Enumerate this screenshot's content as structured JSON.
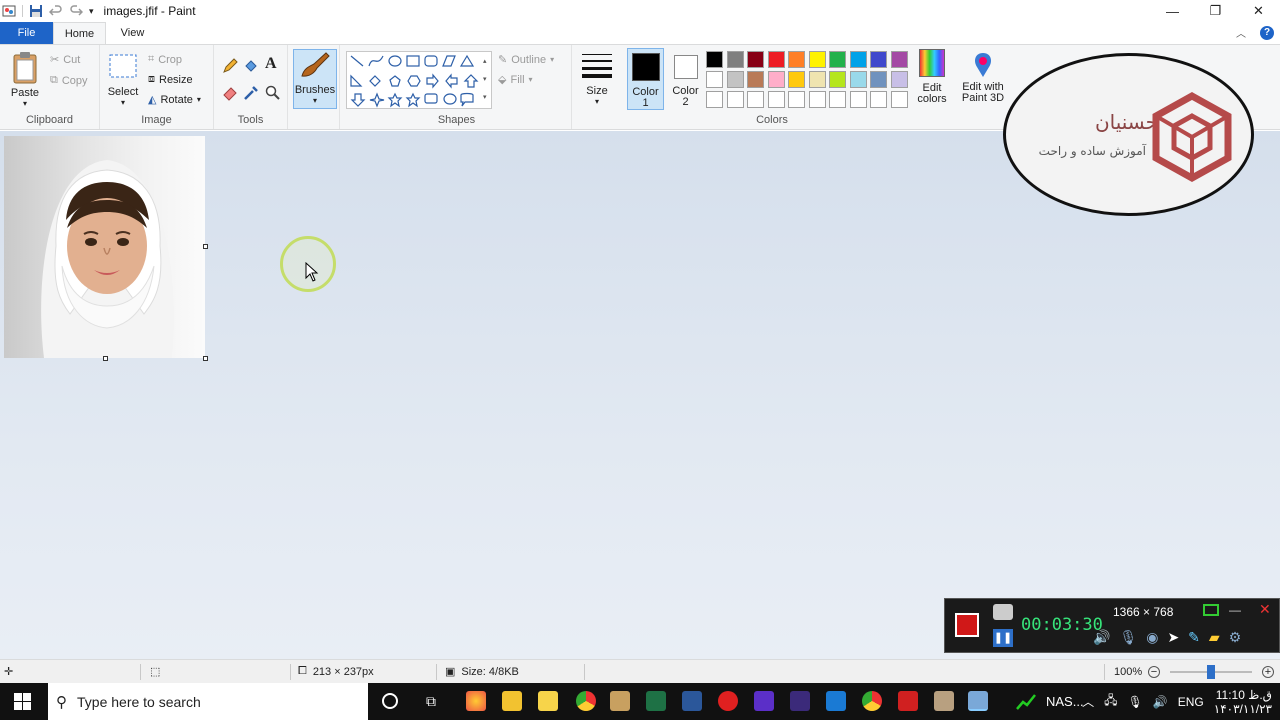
{
  "window": {
    "title": "images.jfif - Paint"
  },
  "tabs": {
    "file": "File",
    "home": "Home",
    "view": "View"
  },
  "ribbon": {
    "clipboard": {
      "label": "Clipboard",
      "paste": "Paste",
      "cut": "Cut",
      "copy": "Copy"
    },
    "image": {
      "label": "Image",
      "select": "Select",
      "crop": "Crop",
      "resize": "Resize",
      "rotate": "Rotate"
    },
    "tools": {
      "label": "Tools"
    },
    "brushes": {
      "label": "Brushes"
    },
    "shapes": {
      "label": "Shapes",
      "outline": "Outline",
      "fill": "Fill"
    },
    "size": {
      "label": "Size"
    },
    "colors": {
      "label": "Colors",
      "color1": "Color\n1",
      "color1_top": "Color",
      "color1_bottom": "1",
      "color2_top": "Color",
      "color2_bottom": "2",
      "edit_colors_top": "Edit",
      "edit_colors_bottom": "colors",
      "paint3d_top": "Edit with",
      "paint3d_bottom": "Paint 3D",
      "palette_row1": [
        "#000000",
        "#7f7f7f",
        "#880015",
        "#ed1c24",
        "#ff7f27",
        "#fff200",
        "#22b14c",
        "#00a2e8",
        "#3f48cc",
        "#a349a4"
      ],
      "palette_row2": [
        "#ffffff",
        "#c3c3c3",
        "#b97a57",
        "#ffaec9",
        "#ffc90e",
        "#efe4b0",
        "#b5e61d",
        "#99d9ea",
        "#7092be",
        "#c8bfe7"
      ],
      "palette_row3": [
        "#ffffff",
        "#ffffff",
        "#ffffff",
        "#ffffff",
        "#ffffff",
        "#ffffff",
        "#ffffff",
        "#ffffff",
        "#ffffff",
        "#ffffff"
      ]
    }
  },
  "logo": {
    "name": "حسنیان",
    "tagline": "آموزش ساده و راحت"
  },
  "recorder": {
    "resolution": "1366 × 768",
    "timer": "00:03:30"
  },
  "status": {
    "dimensions": "213 × 237px",
    "size": "Size: 4/8KB",
    "zoom": "100%"
  },
  "taskbar": {
    "search_placeholder": "Type here to search",
    "nas": "NAS...",
    "lang": "ENG",
    "time": "11:10 ق.ظ",
    "date": "۱۴۰۳/۱۱/۲۳"
  }
}
